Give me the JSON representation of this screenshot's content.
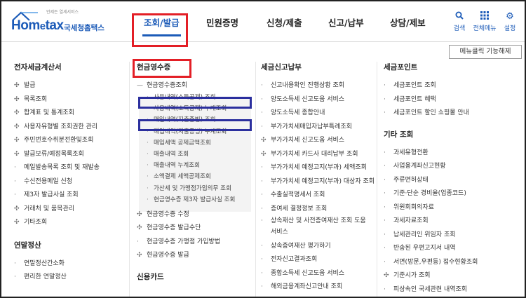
{
  "header": {
    "logo_tagline": "언제든 열세서비스",
    "logo_brand_pre": "Hom",
    "logo_brand_e": "e",
    "logo_brand_post": "tax",
    "logo_brand_kr": "국세청홈택스",
    "nav": [
      "조회/발급",
      "민원증명",
      "신청/제출",
      "신고/납부",
      "상담/제보"
    ],
    "tools": [
      {
        "icon": "search-icon",
        "label": "검색"
      },
      {
        "icon": "grid-icon",
        "label": "전체메뉴"
      },
      {
        "icon": "gear-icon",
        "label": "설정"
      }
    ]
  },
  "menu_button": "메뉴클릭 기능해제",
  "columns": {
    "col1": {
      "title": "전자세금계산서",
      "items": [
        "발급",
        "목록조회",
        "합계표 및 통계조회",
        "사용자유형별 조회권한 관리",
        "주민번호수취분전환및조회",
        "발급보류/예정목록조회",
        "메일발송목록 조회 및 재발송",
        "수신전용메일 신청",
        "제3자 발급사실 조회",
        "거래처 및 품목관리",
        "기타조회"
      ],
      "title2": "연말정산",
      "items2": [
        "연말정산간소화",
        "편리한 연말정산"
      ]
    },
    "col2": {
      "title": "현금영수증",
      "group": "현금영수증조회",
      "subitems": [
        "사용내역(소득공제) 조회",
        "사용내역(소득공제) 누계조회",
        "매입내역(지출증빙) 조회",
        "매입내역(지출증빙) 누계조회",
        "매입세액 공제금액조회",
        "매출내역 조회",
        "매출내역 누계조회",
        "소액결제 세액공제조회",
        "가산세 및 가맹점가입의무 조회",
        "현금영수증 제3자 발급사실 조회"
      ],
      "items": [
        "현금영수증 수정",
        "현금영수증 발급수단",
        "현금영수증 가맹점 가입방법",
        "현금영수증 발급"
      ],
      "title2": "신용카드"
    },
    "col3": {
      "title": "세금신고납부",
      "items": [
        "신고내용확인 진행상황 조회",
        "양도소득세 신고도움 서비스",
        "양도소득세 종합안내",
        "부가가치세매입자납부특례조회",
        "부가가치세 신고도움 서비스",
        "부가가치세 카드사 대리납부 조회",
        "부가가치세 예정고지(부과) 세액조회",
        "부가가치세 예정고지(부과) 대상자 조회",
        "수출실적명세서 조회",
        "증여세 결정정보 조회",
        "상속재산 및 사전증여재산 조회 도움",
        "서비스",
        "상속증여재산 평가하기",
        "전자신고결과조회",
        "종합소득세 신고도움 서비스",
        "해외금융계좌신고안내 조회"
      ]
    },
    "col4": {
      "title": "세금포인트",
      "items": [
        "세금포인트 조회",
        "세금포인트 혜택",
        "세금포인트 할인 쇼핑몰 안내"
      ],
      "title2": "기타 조회",
      "items2": [
        "과세유형전환",
        "사업용계좌신고현황",
        "주류면허상태",
        "기준·단순 경비율(업종코드)",
        "위원회회의자료",
        "과세자료조회",
        "납세관리인 위임자 조회",
        "반송된 우편고지서 내역",
        "서면(방문,우편등) 접수현황조회",
        "기준시가 조회",
        "피상속인 국세관련 내역조회"
      ]
    }
  }
}
